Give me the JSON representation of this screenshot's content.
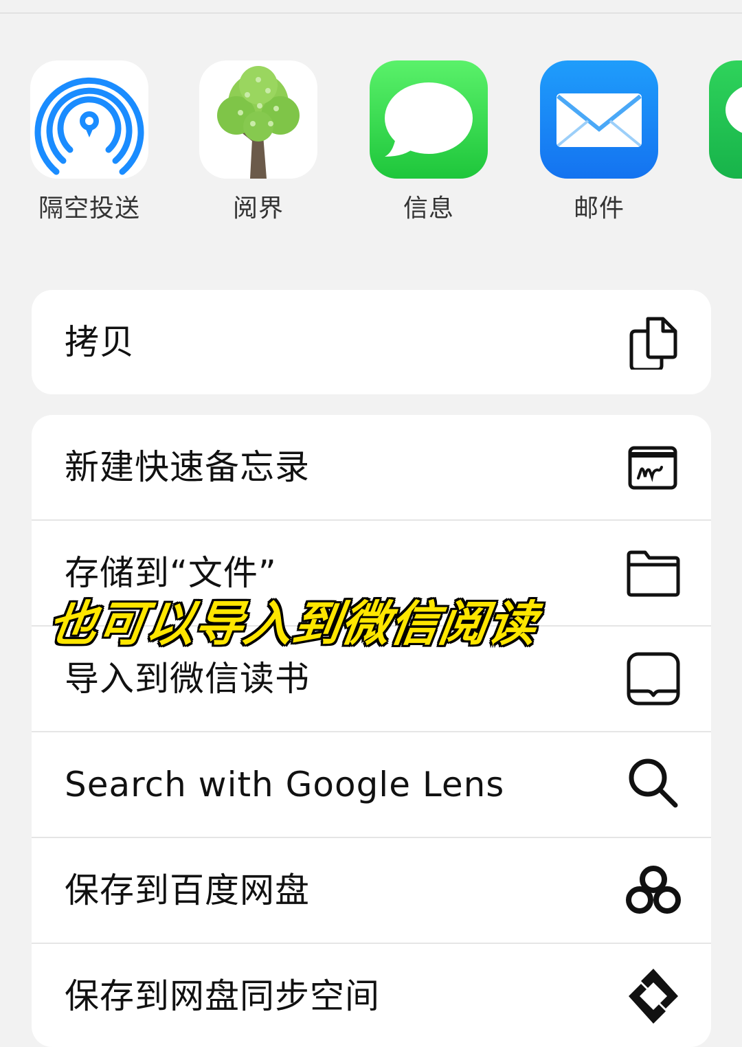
{
  "apps": [
    {
      "label": "隔空投送",
      "icon": "airdrop-icon"
    },
    {
      "label": "阅界",
      "icon": "tree-icon"
    },
    {
      "label": "信息",
      "icon": "message-bubble-icon"
    },
    {
      "label": "邮件",
      "icon": "envelope-icon"
    },
    {
      "label": "",
      "icon": "wechat-icon"
    }
  ],
  "actions_group1": [
    {
      "label": "拷贝",
      "icon": "copy-icon"
    }
  ],
  "actions_group2": [
    {
      "label": "新建快速备忘录",
      "icon": "quick-note-icon"
    },
    {
      "label": "存储到“文件”",
      "icon": "folder-icon"
    },
    {
      "label": "导入到微信读书",
      "icon": "book-tray-icon"
    },
    {
      "label": "Search with Google Lens",
      "icon": "search-icon"
    },
    {
      "label": "保存到百度网盘",
      "icon": "baidu-cloud-icon"
    },
    {
      "label": "保存到网盘同步空间",
      "icon": "sync-space-icon"
    }
  ],
  "overlay_caption": "也可以导入到微信阅读",
  "colors": {
    "background": "#f2f2f2",
    "card": "#ffffff",
    "overlay_text": "#ffe600",
    "airdrop_blue": "#1a8cff",
    "messages_green": "#1ec63b",
    "mail_blue": "#1473f0"
  }
}
